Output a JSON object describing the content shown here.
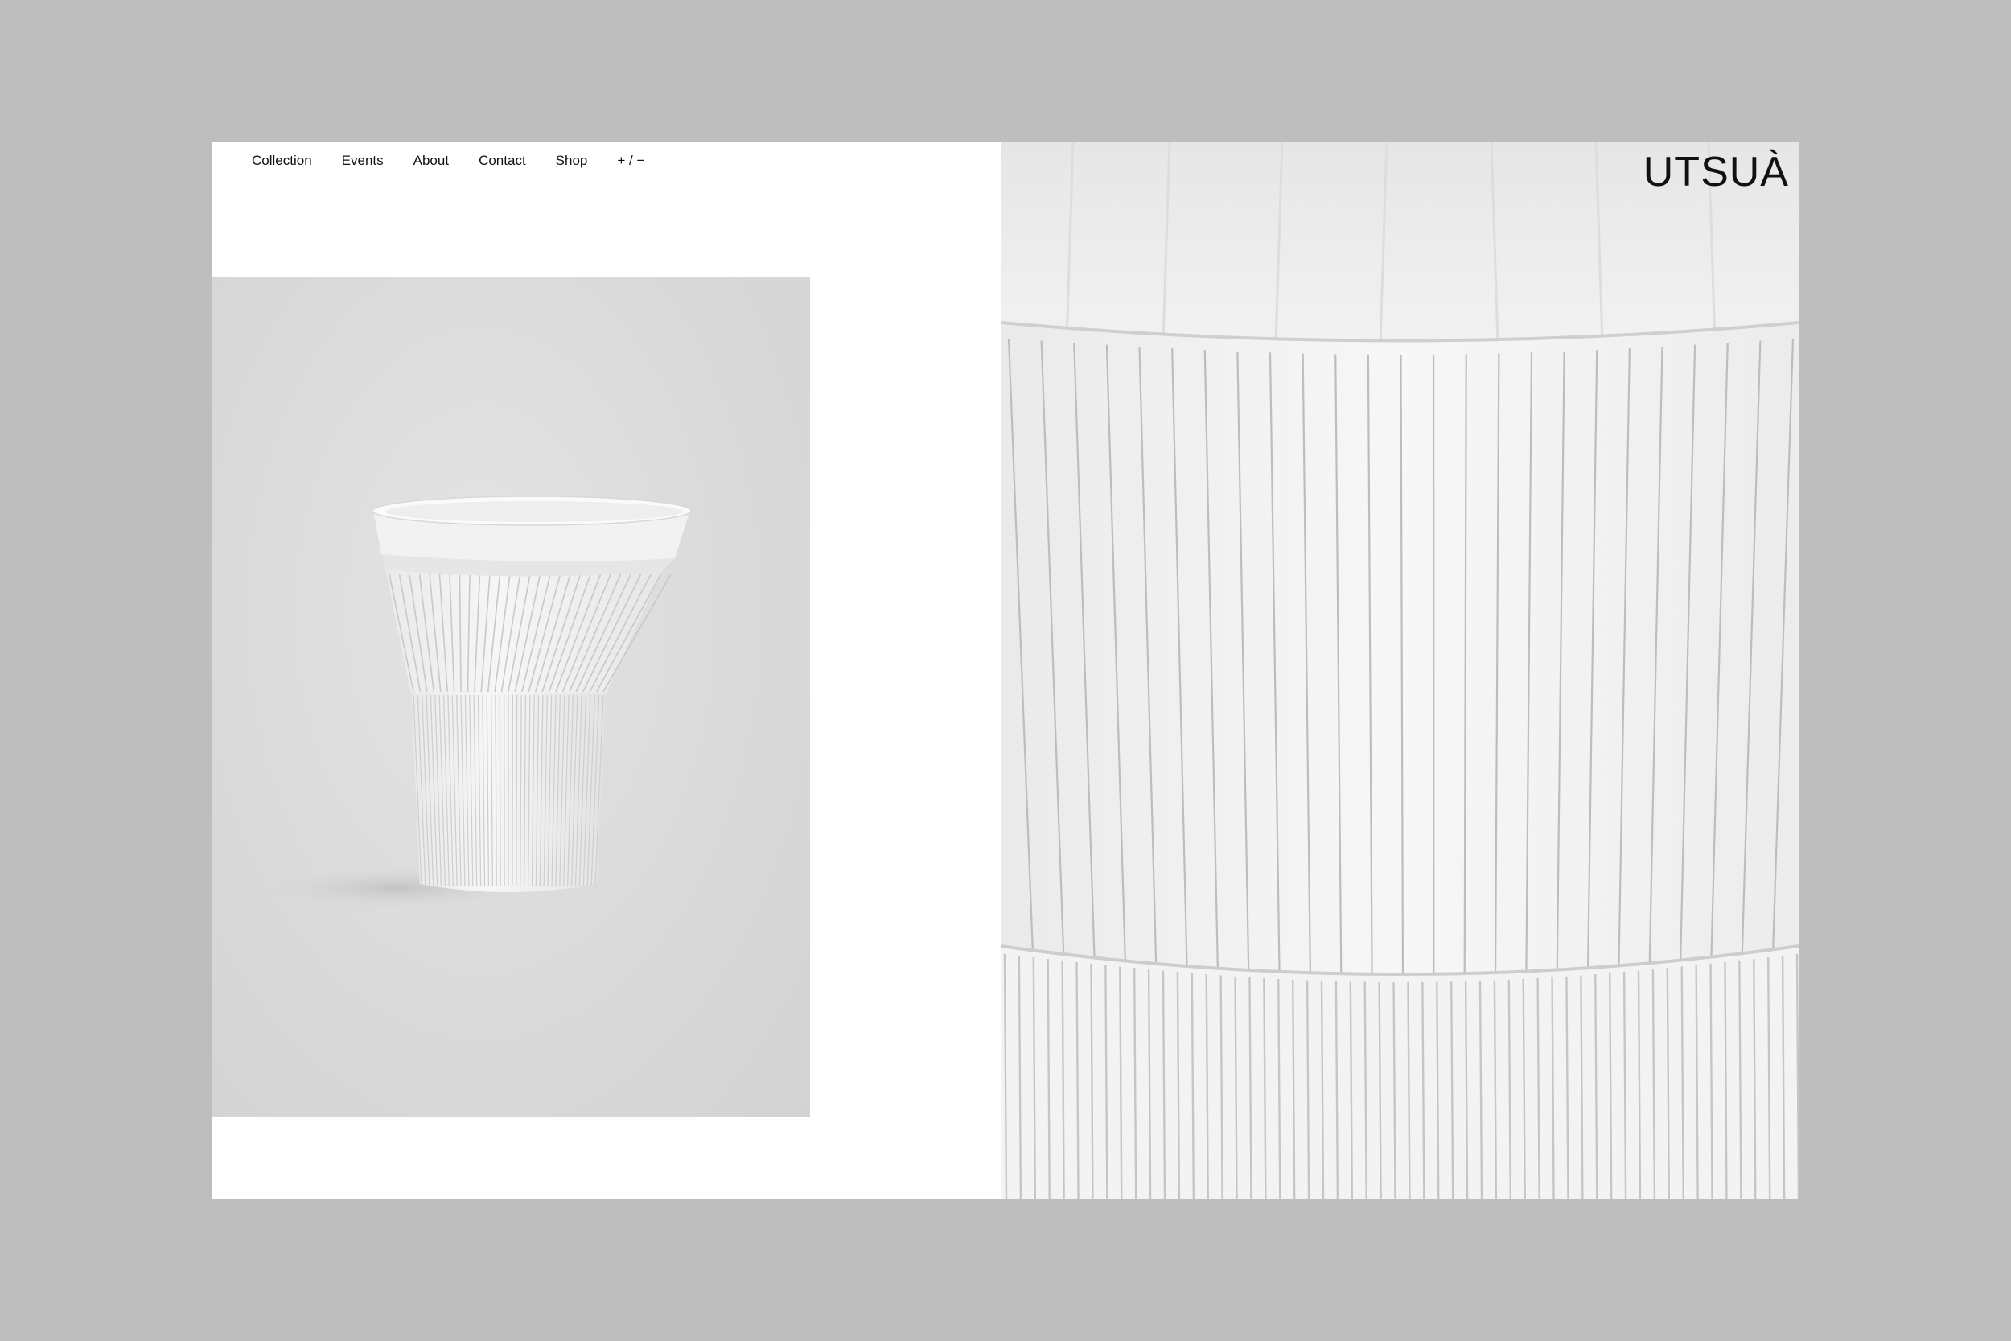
{
  "nav": {
    "items": [
      {
        "label": "Collection",
        "name": "nav-collection"
      },
      {
        "label": "Events",
        "name": "nav-events"
      },
      {
        "label": "About",
        "name": "nav-about"
      },
      {
        "label": "Contact",
        "name": "nav-contact"
      },
      {
        "label": "Shop",
        "name": "nav-shop"
      },
      {
        "label": "+ / −",
        "name": "nav-zoom-toggle"
      }
    ]
  },
  "brand": {
    "logo_text": "UTSUÀ"
  },
  "colors": {
    "page_background": "#bebebe",
    "panel_background": "#ffffff",
    "text": "#111111"
  }
}
